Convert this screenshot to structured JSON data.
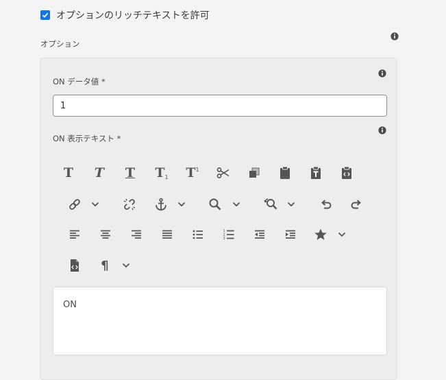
{
  "rich_text_option": {
    "label": "オプションのリッチテキストを許可",
    "checked": true
  },
  "options_section": {
    "label": "オプション"
  },
  "on_data_value": {
    "label": "ON データ値 *",
    "value": "1"
  },
  "on_display_text": {
    "label": "ON 表示テキスト *"
  },
  "toolbar": {
    "bold_glyph": "T",
    "italic_glyph": "T",
    "underline_glyph": "T",
    "subscript_glyph": "T",
    "subscript_mark": "1",
    "superscript_glyph": "T",
    "superscript_mark": "1",
    "paragraph_glyph": "¶"
  },
  "editor": {
    "content": "ON"
  },
  "colors": {
    "accent": "#1473e6",
    "icon": "#555555"
  }
}
